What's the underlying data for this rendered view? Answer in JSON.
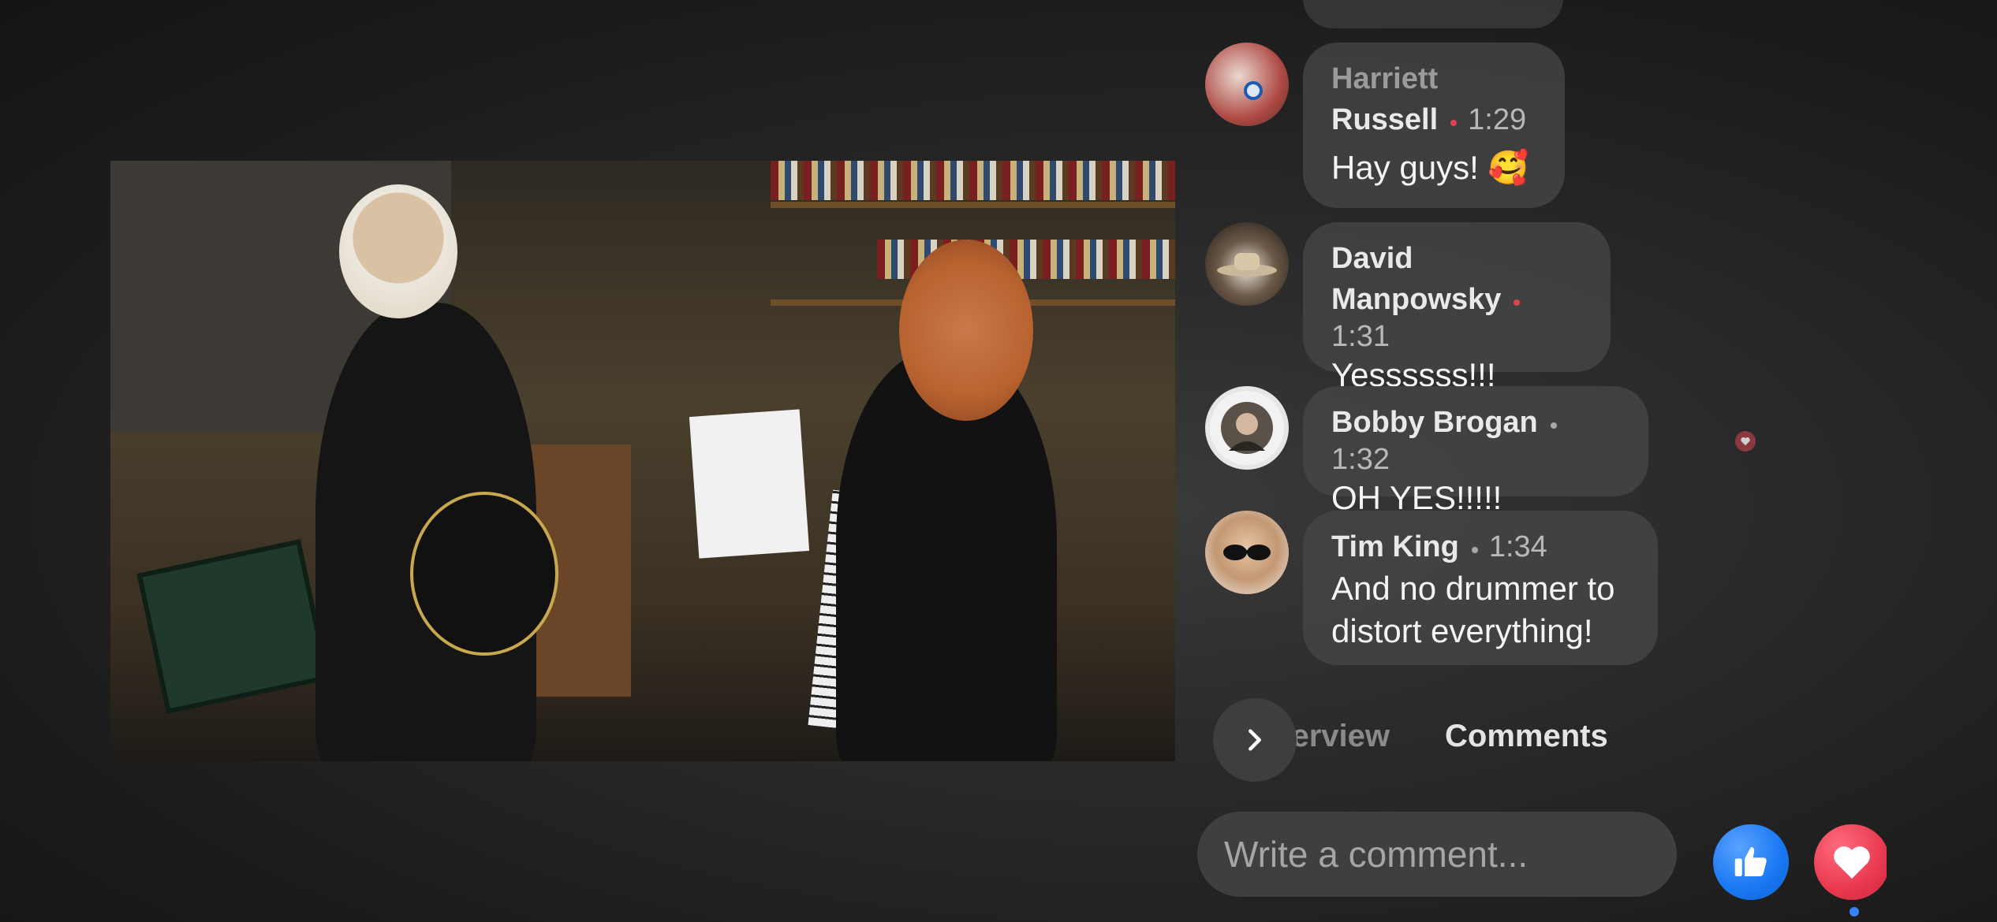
{
  "live_video": {
    "description_hidden": true
  },
  "comments": [
    {
      "first_name": "Harriett",
      "last_name": "Russell",
      "time": "1:29",
      "text": "Hay guys! 🥰",
      "avatar": "vaccine-badge-avatar",
      "dot_color": "#e0424e"
    },
    {
      "first_name": "David",
      "last_name": "Manpowsky",
      "time": "1:31",
      "text": "Yessssss!!!",
      "avatar": "cowboy-hat-avatar",
      "dot_color": "#e0424e"
    },
    {
      "name": "Bobby Brogan",
      "time": "1:32",
      "text": "OH YES!!!!!",
      "avatar": "circular-badge-avatar",
      "dot_color": "#a8a8a8"
    },
    {
      "name": "Tim King",
      "time": "1:34",
      "text_line1": "And no drummer to",
      "text_line2": "distort everything!",
      "avatar": "sunglasses-avatar",
      "dot_color": "#a8a8a8"
    }
  ],
  "tabs": {
    "overview": "Overview",
    "comments": "Comments"
  },
  "composer": {
    "placeholder": "Write a comment..."
  },
  "reactions": {
    "like": "thumbs-up-icon",
    "love": "heart-icon"
  },
  "colors": {
    "like": "#1877f2",
    "love": "#e8384f",
    "indicator": "#3a82f7"
  }
}
